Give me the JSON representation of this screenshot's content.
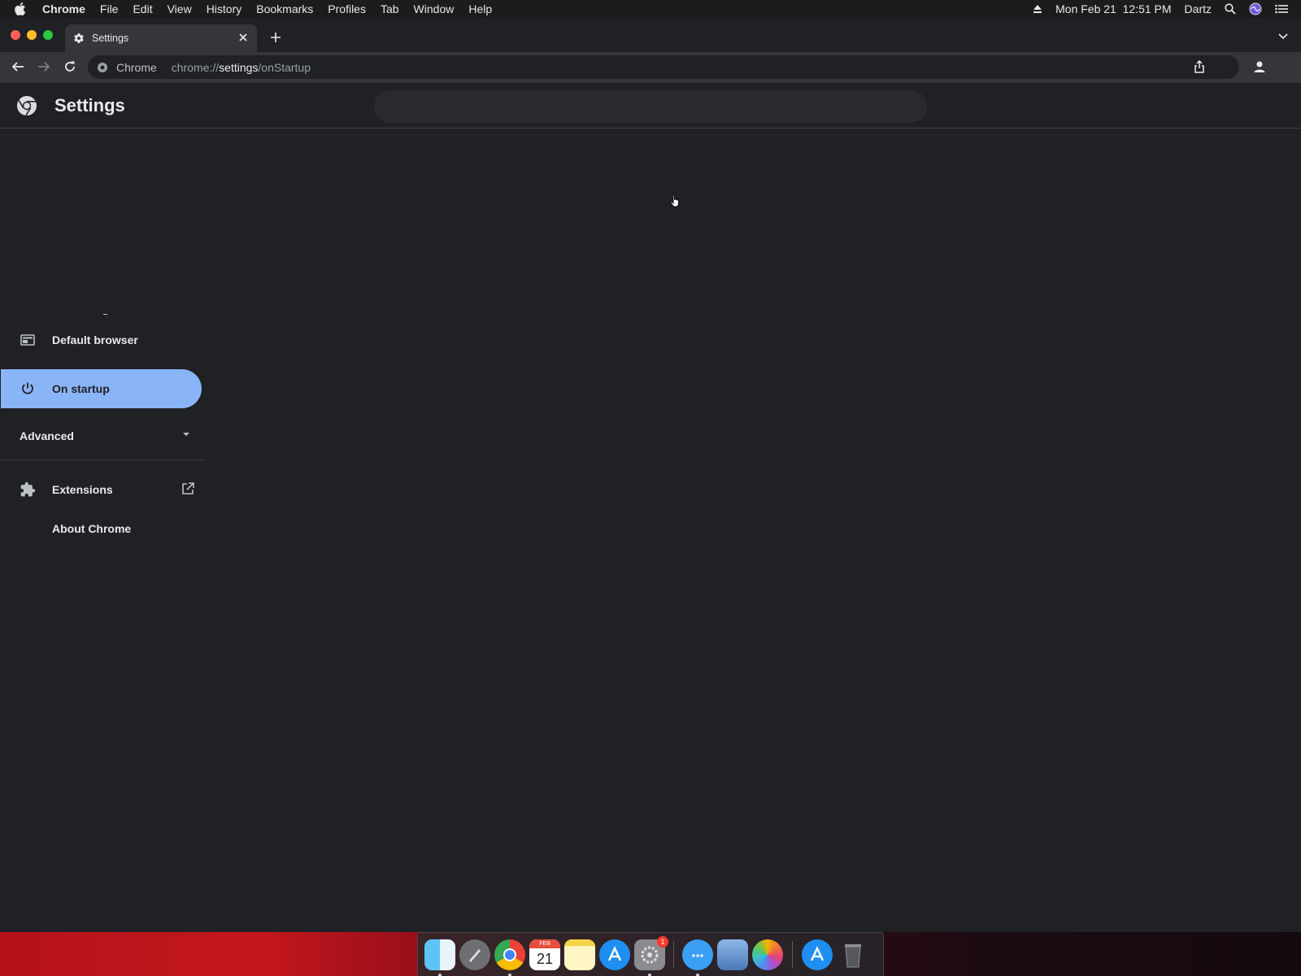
{
  "menubar": {
    "app": "Chrome",
    "items": [
      "File",
      "Edit",
      "View",
      "History",
      "Bookmarks",
      "Profiles",
      "Tab",
      "Window",
      "Help"
    ],
    "datetime": "Mon Feb 21  12:51 PM",
    "user": "Dartz"
  },
  "tab": {
    "title": "Settings"
  },
  "omnibox": {
    "chip": "Chrome",
    "url_prefix": "chrome://",
    "url_host": "settings",
    "url_path": "/onStartup"
  },
  "header": {
    "title": "Settings"
  },
  "sidebar": {
    "items": [
      {
        "label": "Default browser"
      },
      {
        "label": "On startup",
        "active": true
      }
    ],
    "advanced_label": "Advanced",
    "extensions_label": "Extensions",
    "about_label": "About Chrome"
  },
  "dock": {
    "calendar_month": "FEB",
    "calendar_day": "21",
    "settings_badge": "1"
  },
  "colors": {
    "background": "#202124",
    "toolbar": "#35363a",
    "accent": "#8ab4f8",
    "text": "#e8eaed"
  }
}
